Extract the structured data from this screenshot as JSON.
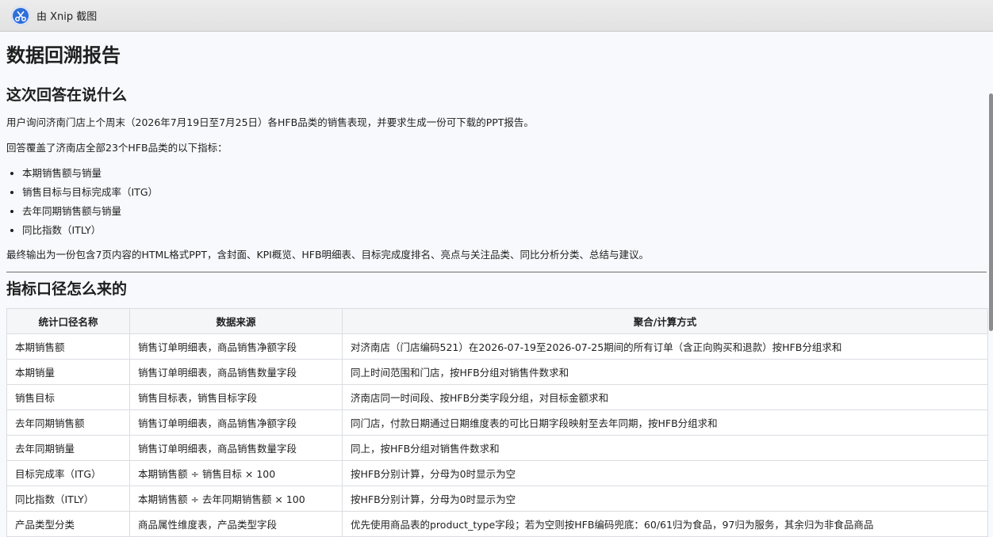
{
  "window": {
    "title": "由 Xnip 截图"
  },
  "report": {
    "title": "数据回溯报告",
    "section1": {
      "heading": "这次回答在说什么",
      "para1": "用户询问济南门店上个周末（2026年7月19日至7月25日）各HFB品类的销售表现，并要求生成一份可下载的PPT报告。",
      "para2": "回答覆盖了济南店全部23个HFB品类的以下指标：",
      "bullets": [
        "本期销售额与销量",
        "销售目标与目标完成率（ITG）",
        "去年同期销售额与销量",
        "同比指数（ITLY）"
      ],
      "para3": "最终输出为一份包含7页内容的HTML格式PPT，含封面、KPI概览、HFB明细表、目标完成度排名、亮点与关注品类、同比分析分类、总结与建议。"
    },
    "section2": {
      "heading": "指标口径怎么来的",
      "columns": [
        "统计口径名称",
        "数据来源",
        "聚合/计算方式"
      ],
      "rows": [
        [
          "本期销售额",
          "销售订单明细表，商品销售净额字段",
          "对济南店（门店编码521）在2026-07-19至2026-07-25期间的所有订单（含正向购买和退款）按HFB分组求和"
        ],
        [
          "本期销量",
          "销售订单明细表，商品销售数量字段",
          "同上时间范围和门店，按HFB分组对销售件数求和"
        ],
        [
          "销售目标",
          "销售目标表，销售目标字段",
          "济南店同一时间段、按HFB分类字段分组，对目标金额求和"
        ],
        [
          "去年同期销售额",
          "销售订单明细表，商品销售净额字段",
          "同门店，付款日期通过日期维度表的可比日期字段映射至去年同期，按HFB分组求和"
        ],
        [
          "去年同期销量",
          "销售订单明细表，商品销售数量字段",
          "同上，按HFB分组对销售件数求和"
        ],
        [
          "目标完成率（ITG）",
          "本期销售额 ÷ 销售目标 × 100",
          "按HFB分别计算，分母为0时显示为空"
        ],
        [
          "同比指数（ITLY）",
          "本期销售额 ÷ 去年同期销售额 × 100",
          "按HFB分别计算，分母为0时显示为空"
        ],
        [
          "产品类型分类",
          "商品属性维度表，产品类型字段",
          "优先使用商品表的product_type字段；若为空则按HFB编码兜底：60/61归为食品，97归为服务，其余归为非食品商品"
        ]
      ]
    }
  },
  "colors": {
    "app_icon": "#2f6fd8",
    "background": "#f7f9fc"
  },
  "icons": {
    "app": "xnip-scissors-icon"
  }
}
